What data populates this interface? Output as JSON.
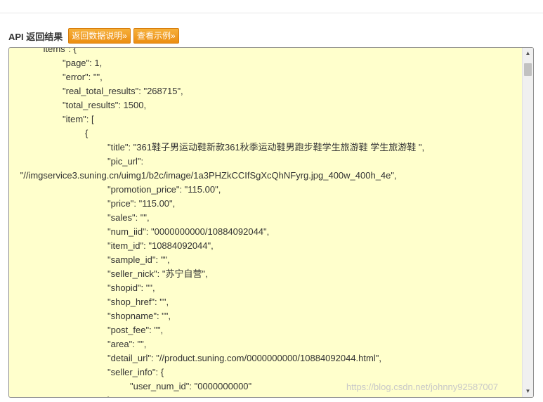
{
  "header": {
    "title": "API 返回结果",
    "doc_button": "返回数据说明»",
    "example_button": "查看示例»"
  },
  "code": {
    "lines": [
      "\t\"items\": {",
      "\t\t\"page\": 1,",
      "\t\t\"error\": \"\",",
      "\t\t\"real_total_results\": \"268715\",",
      "\t\t\"total_results\": 1500,",
      "\t\t\"item\": [",
      "\t\t\t{",
      "\t\t\t\t\"title\": \"361鞋子男运动鞋新款361秋季运动鞋男跑步鞋学生旅游鞋 学生旅游鞋 \",",
      "\t\t\t\t\"pic_url\":",
      " \"//imgservice3.suning.cn/uimg1/b2c/image/1a3PHZkCCIfSgXcQhNFyrg.jpg_400w_400h_4e\",",
      "\t\t\t\t\"promotion_price\": \"115.00\",",
      "\t\t\t\t\"price\": \"115.00\",",
      "\t\t\t\t\"sales\": \"\",",
      "\t\t\t\t\"num_iid\": \"0000000000/10884092044\",",
      "\t\t\t\t\"item_id\": \"10884092044\",",
      "\t\t\t\t\"sample_id\": \"\",",
      "\t\t\t\t\"seller_nick\": \"苏宁自营\",",
      "\t\t\t\t\"shopid\": \"\",",
      "\t\t\t\t\"shop_href\": \"\",",
      "\t\t\t\t\"shopname\": \"\",",
      "\t\t\t\t\"post_fee\": \"\",",
      "\t\t\t\t\"area\": \"\",",
      "\t\t\t\t\"detail_url\": \"//product.suning.com/0000000000/10884092044.html\",",
      "\t\t\t\t\"seller_info\": {",
      "\t\t\t\t\t\"user_num_id\": \"0000000000\"",
      "\t\t\t\t}"
    ]
  },
  "watermark": "https://blog.csdn.net/johnny92587007",
  "colors": {
    "code_background": "#ffffcc",
    "button_orange": "#f0a030"
  }
}
